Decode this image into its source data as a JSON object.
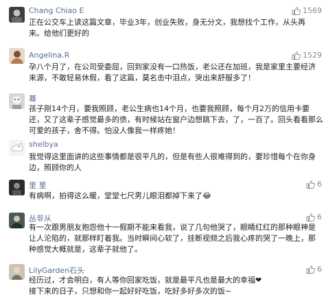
{
  "comments": [
    {
      "name": "Chang Chiao E",
      "likes": "1569",
      "lines": [
        "正在公交车上读这篇文章，毕业3年，创业失败，身无分文，我想找个工作，从头再",
        "来。给他们更好的"
      ]
    },
    {
      "name": "Angelina.R",
      "likes": "1529",
      "lines": [
        "孕八个月了，在公司受委屈，回到家没有一口热饭，老公还在加班，我是家里主要经济",
        "来源，不敢轻易休假，看了这篇，莫名击中泪点，哭出来舒服多了！"
      ]
    },
    {
      "name": "蓦",
      "likes": "",
      "lines": [
        "孩子刚14个月，要我照顾，老公生病也14个月，也要我照顾，每个月2万的信用卡要",
        "还，又了这辈子感觉最多的债，有时候站在窗户边想跳下去，了，一百了。回头看看那么",
        "可爱的孩子，舍不得。怕没人像我一样疼她！"
      ]
    },
    {
      "name": "shelbya",
      "likes": "",
      "lines": [
        "我觉得这里面讲的这些事情都是很平凡的，但是有些人很难得到的，要珍惜每个在你身",
        "边，照顾你的人"
      ]
    },
    {
      "name": "里 里",
      "likes": "6",
      "lines": [
        "有病啊，拍得这么暖，堂堂七尺男儿眼泪都掉下来了😂"
      ]
    },
    {
      "name": "丛非从",
      "likes": "6",
      "lines": [
        "有一次跟男朋友抱怨他十一假期不能来看我，说了几句他哭了，眼睛红红的那种眼神是",
        "让人沦陷的，就那样盯着我。当时瞬间心软了，挂断视频之后我心疼的哭了一晚上，那",
        "种感觉大概就是，这辈子就他了。"
      ]
    },
    {
      "name": "LilyGarden石头",
      "likes": "6",
      "lines": [
        "经历过，才会明白，有人等你回家吃饭，就是最平凡也是最大的幸福❤",
        "接下来的日子，只想和你一起好好吃饭，吃好多好多次的饭~"
      ]
    }
  ],
  "colors": {
    "name": "#576b95",
    "text": "#222222",
    "like": "#8a8a8a"
  },
  "icons": {
    "like": "thumbs-up-icon"
  }
}
